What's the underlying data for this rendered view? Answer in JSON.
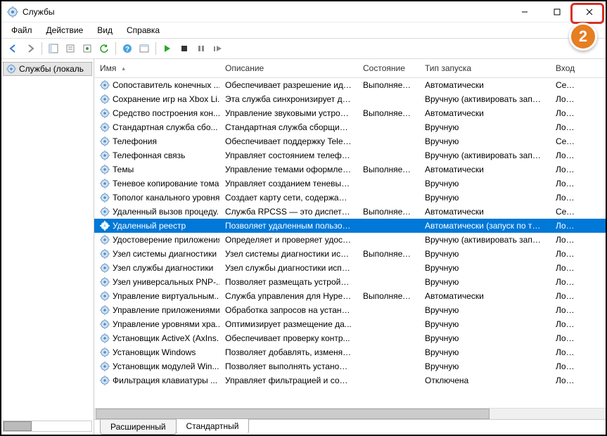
{
  "title": "Службы",
  "menu": {
    "file": "Файл",
    "action": "Действие",
    "view": "Вид",
    "help": "Справка"
  },
  "tree": {
    "label": "Службы (локаль"
  },
  "columns": {
    "name": "Имя",
    "desc": "Описание",
    "state": "Состояние",
    "start": "Тип запуска",
    "logon": "Вход"
  },
  "tabs": {
    "ext": "Расширенный",
    "std": "Стандартный"
  },
  "badge": "2",
  "rows": [
    {
      "name": "Сопоставитель конечных ...",
      "desc": "Обеспечивает разрешение иде...",
      "state": "Выполняется",
      "start": "Автоматически",
      "logon": "Сетев"
    },
    {
      "name": "Сохранение игр на Xbox Li...",
      "desc": "Эта служба синхронизирует да...",
      "state": "",
      "start": "Вручную (активировать запуск)",
      "logon": "Локал"
    },
    {
      "name": "Средство построения кон...",
      "desc": "Управление звуковыми устрой...",
      "state": "Выполняется",
      "start": "Автоматически",
      "logon": "Локал"
    },
    {
      "name": "Стандартная служба сбо...",
      "desc": "Стандартная служба сборщика...",
      "state": "",
      "start": "Вручную",
      "logon": "Локал"
    },
    {
      "name": "Телефония",
      "desc": "Обеспечивает поддержку Telep...",
      "state": "",
      "start": "Вручную",
      "logon": "Сетев"
    },
    {
      "name": "Телефонная связь",
      "desc": "Управляет состоянием телефо...",
      "state": "",
      "start": "Вручную (активировать запуск)",
      "logon": "Локал"
    },
    {
      "name": "Темы",
      "desc": "Управление темами оформлен...",
      "state": "Выполняется",
      "start": "Автоматически",
      "logon": "Локал"
    },
    {
      "name": "Теневое копирование тома",
      "desc": "Управляет созданием теневых ...",
      "state": "",
      "start": "Вручную",
      "logon": "Локал"
    },
    {
      "name": "Тополог канального уровня",
      "desc": "Создает карту сети, содержащу...",
      "state": "",
      "start": "Вручную",
      "logon": "Локал"
    },
    {
      "name": "Удаленный вызов процеду...",
      "desc": "Служба RPCSS — это диспетче...",
      "state": "Выполняется",
      "start": "Автоматически",
      "logon": "Сетев"
    },
    {
      "name": "Удаленный реестр",
      "desc": "Позволяет удаленным пользов...",
      "state": "",
      "start": "Автоматически (запуск по три...",
      "logon": "Локал",
      "selected": true
    },
    {
      "name": "Удостоверение приложения",
      "desc": "Определяет и проверяет удост...",
      "state": "",
      "start": "Вручную (активировать запуск)",
      "logon": "Локал"
    },
    {
      "name": "Узел системы диагностики",
      "desc": "Узел системы диагностики исп...",
      "state": "Выполняется",
      "start": "Вручную",
      "logon": "Локал"
    },
    {
      "name": "Узел службы диагностики",
      "desc": "Узел службы диагностики испо...",
      "state": "",
      "start": "Вручную",
      "logon": "Локал"
    },
    {
      "name": "Узел универсальных PNP-...",
      "desc": "Позволяет размещать устройст...",
      "state": "",
      "start": "Вручную",
      "logon": "Локал"
    },
    {
      "name": "Управление виртуальным...",
      "desc": "Служба управления для Hyper-...",
      "state": "Выполняется",
      "start": "Автоматически",
      "logon": "Локал"
    },
    {
      "name": "Управление приложениями",
      "desc": "Обработка запросов на устано...",
      "state": "",
      "start": "Вручную",
      "logon": "Локал"
    },
    {
      "name": "Управление уровнями хра...",
      "desc": "Оптимизирует размещение да...",
      "state": "",
      "start": "Вручную",
      "logon": "Локал"
    },
    {
      "name": "Установщик ActiveX (AxIns...",
      "desc": "Обеспечивает проверку контр...",
      "state": "",
      "start": "Вручную",
      "logon": "Локал"
    },
    {
      "name": "Установщик Windows",
      "desc": "Позволяет добавлять, изменят...",
      "state": "",
      "start": "Вручную",
      "logon": "Локал"
    },
    {
      "name": "Установщик модулей Win...",
      "desc": "Позволяет выполнять установк...",
      "state": "",
      "start": "Вручную",
      "logon": "Локал"
    },
    {
      "name": "Фильтрация клавиатуры ...",
      "desc": "Управляет фильтрацией и сопо...",
      "state": "",
      "start": "Отключена",
      "logon": "Локал"
    }
  ]
}
